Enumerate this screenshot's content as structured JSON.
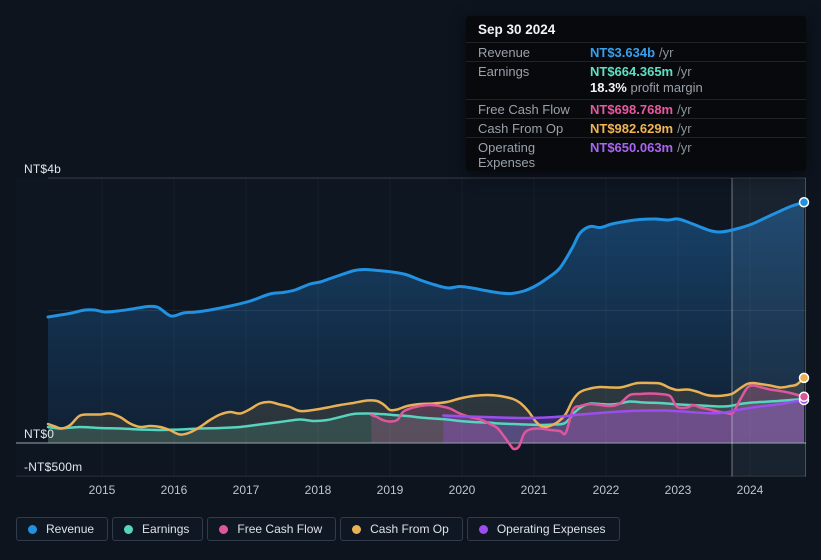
{
  "tooltip": {
    "date": "Sep 30 2024",
    "rows": [
      {
        "label": "Revenue",
        "value": "NT$3.634b",
        "unit": "/yr",
        "color": "#38a0ee"
      },
      {
        "label": "Earnings",
        "value": "NT$664.365m",
        "unit": "/yr",
        "color": "#5fe0c5"
      },
      {
        "label": "Free Cash Flow",
        "value": "NT$698.768m",
        "unit": "/yr",
        "color": "#ea579e"
      },
      {
        "label": "Cash From Op",
        "value": "NT$982.629m",
        "unit": "/yr",
        "color": "#f0b551"
      },
      {
        "label": "Operating Expenses",
        "value": "NT$650.063m",
        "unit": "/yr",
        "color": "#aa65f0"
      }
    ],
    "profit_margin": {
      "value": "18.3%",
      "label": "profit margin"
    }
  },
  "legend": {
    "items": [
      {
        "id": "revenue",
        "label": "Revenue",
        "color": "#2191e2"
      },
      {
        "id": "earnings",
        "label": "Earnings",
        "color": "#56d4be"
      },
      {
        "id": "fcf",
        "label": "Free Cash Flow",
        "color": "#e0569d"
      },
      {
        "id": "cfo",
        "label": "Cash From Op",
        "color": "#e9b156"
      },
      {
        "id": "opex",
        "label": "Operating Expenses",
        "color": "#9b4ded"
      }
    ]
  },
  "chart_data": {
    "type": "line",
    "title": "Earnings and revenue history (TTM, NT$ millions)",
    "xlim": [
      2014.25,
      2024.78
    ],
    "ylim": [
      -500,
      4000
    ],
    "x_ticks": [
      "2015",
      "2016",
      "2017",
      "2018",
      "2019",
      "2020",
      "2021",
      "2022",
      "2023",
      "2024"
    ],
    "y_ticks": [
      {
        "label": "NT$4b",
        "value": 4000
      },
      {
        "label": "NT$0",
        "value": 0
      },
      {
        "label": "-NT$500m",
        "value": -500
      }
    ],
    "y_gridline_values": [
      4000,
      2000,
      0,
      -500
    ],
    "hover_band": [
      2023.75,
      2024.78
    ],
    "line_z_order": [
      "earnings",
      "cfo",
      "fcf",
      "opex",
      "revenue"
    ],
    "dots": [
      {
        "series": "cfo",
        "year": 2024.75,
        "value": 983
      },
      {
        "series": "opex",
        "year": 2024.75,
        "value": 650
      },
      {
        "series": "fcf",
        "year": 2024.75,
        "value": 699
      },
      {
        "series": "revenue",
        "year": 2024.75,
        "value": 3634
      }
    ],
    "series": [
      {
        "id": "revenue",
        "name": "Revenue",
        "color": "#2191e2",
        "fill": "gradient",
        "points": [
          [
            2014.25,
            1902
          ],
          [
            2014.42,
            1932
          ],
          [
            2014.58,
            1962
          ],
          [
            2014.76,
            2008
          ],
          [
            2014.9,
            2008
          ],
          [
            2015.04,
            1977
          ],
          [
            2015.22,
            1992
          ],
          [
            2015.42,
            2023
          ],
          [
            2015.64,
            2060
          ],
          [
            2015.78,
            2045
          ],
          [
            2015.96,
            1917
          ],
          [
            2016.13,
            1962
          ],
          [
            2016.31,
            1977
          ],
          [
            2016.5,
            2008
          ],
          [
            2016.78,
            2068
          ],
          [
            2017.06,
            2143
          ],
          [
            2017.33,
            2249
          ],
          [
            2017.51,
            2272
          ],
          [
            2017.68,
            2309
          ],
          [
            2017.89,
            2400
          ],
          [
            2018.03,
            2430
          ],
          [
            2018.17,
            2483
          ],
          [
            2018.33,
            2543
          ],
          [
            2018.51,
            2604
          ],
          [
            2018.65,
            2619
          ],
          [
            2018.83,
            2604
          ],
          [
            2019.03,
            2581
          ],
          [
            2019.22,
            2543
          ],
          [
            2019.42,
            2460
          ],
          [
            2019.63,
            2385
          ],
          [
            2019.81,
            2340
          ],
          [
            2019.97,
            2362
          ],
          [
            2020.14,
            2340
          ],
          [
            2020.32,
            2302
          ],
          [
            2020.53,
            2264
          ],
          [
            2020.69,
            2257
          ],
          [
            2020.86,
            2294
          ],
          [
            2021.03,
            2377
          ],
          [
            2021.19,
            2491
          ],
          [
            2021.36,
            2642
          ],
          [
            2021.53,
            2944
          ],
          [
            2021.64,
            3170
          ],
          [
            2021.78,
            3268
          ],
          [
            2021.92,
            3253
          ],
          [
            2022.08,
            3306
          ],
          [
            2022.26,
            3343
          ],
          [
            2022.47,
            3374
          ],
          [
            2022.68,
            3381
          ],
          [
            2022.86,
            3366
          ],
          [
            2023.0,
            3381
          ],
          [
            2023.17,
            3321
          ],
          [
            2023.31,
            3260
          ],
          [
            2023.44,
            3208
          ],
          [
            2023.56,
            3185
          ],
          [
            2023.69,
            3200
          ],
          [
            2023.86,
            3245
          ],
          [
            2024.03,
            3306
          ],
          [
            2024.21,
            3396
          ],
          [
            2024.39,
            3487
          ],
          [
            2024.58,
            3577
          ],
          [
            2024.75,
            3634
          ]
        ]
      },
      {
        "id": "earnings",
        "name": "Earnings",
        "color": "#56d4be",
        "fill": "rgba(86,212,190,0.16)",
        "points": [
          [
            2014.25,
            241
          ],
          [
            2014.42,
            219
          ],
          [
            2014.69,
            241
          ],
          [
            2014.97,
            226
          ],
          [
            2015.25,
            219
          ],
          [
            2015.53,
            204
          ],
          [
            2015.81,
            196
          ],
          [
            2016.08,
            204
          ],
          [
            2016.36,
            219
          ],
          [
            2016.64,
            226
          ],
          [
            2016.92,
            241
          ],
          [
            2017.19,
            279
          ],
          [
            2017.47,
            317
          ],
          [
            2017.75,
            355
          ],
          [
            2017.93,
            332
          ],
          [
            2018.13,
            347
          ],
          [
            2018.31,
            392
          ],
          [
            2018.49,
            438
          ],
          [
            2018.68,
            445
          ],
          [
            2018.86,
            438
          ],
          [
            2019.04,
            423
          ],
          [
            2019.24,
            408
          ],
          [
            2019.42,
            385
          ],
          [
            2019.6,
            370
          ],
          [
            2019.79,
            355
          ],
          [
            2019.97,
            332
          ],
          [
            2020.15,
            317
          ],
          [
            2020.35,
            309
          ],
          [
            2020.53,
            294
          ],
          [
            2020.71,
            287
          ],
          [
            2020.9,
            279
          ],
          [
            2021.08,
            272
          ],
          [
            2021.26,
            279
          ],
          [
            2021.43,
            302
          ],
          [
            2021.57,
            468
          ],
          [
            2021.68,
            558
          ],
          [
            2021.78,
            596
          ],
          [
            2021.92,
            589
          ],
          [
            2022.06,
            581
          ],
          [
            2022.19,
            596
          ],
          [
            2022.33,
            626
          ],
          [
            2022.54,
            611
          ],
          [
            2022.75,
            604
          ],
          [
            2022.96,
            586
          ],
          [
            2023.17,
            574
          ],
          [
            2023.38,
            562
          ],
          [
            2023.58,
            551
          ],
          [
            2023.72,
            558
          ],
          [
            2023.86,
            589
          ],
          [
            2024.03,
            611
          ],
          [
            2024.21,
            622
          ],
          [
            2024.39,
            634
          ],
          [
            2024.56,
            649
          ],
          [
            2024.75,
            664
          ]
        ]
      },
      {
        "id": "cfo",
        "name": "Cash From Op",
        "color": "#e9b156",
        "fill": "rgba(233,177,86,0.13)",
        "points": [
          [
            2014.25,
            287
          ],
          [
            2014.35,
            249
          ],
          [
            2014.44,
            219
          ],
          [
            2014.56,
            272
          ],
          [
            2014.69,
            412
          ],
          [
            2014.83,
            430
          ],
          [
            2014.97,
            430
          ],
          [
            2015.11,
            445
          ],
          [
            2015.25,
            392
          ],
          [
            2015.39,
            294
          ],
          [
            2015.53,
            241
          ],
          [
            2015.67,
            257
          ],
          [
            2015.81,
            241
          ],
          [
            2015.94,
            196
          ],
          [
            2016.08,
            128
          ],
          [
            2016.22,
            158
          ],
          [
            2016.36,
            241
          ],
          [
            2016.5,
            347
          ],
          [
            2016.64,
            430
          ],
          [
            2016.78,
            468
          ],
          [
            2016.92,
            445
          ],
          [
            2017.06,
            513
          ],
          [
            2017.19,
            596
          ],
          [
            2017.33,
            619
          ],
          [
            2017.47,
            581
          ],
          [
            2017.61,
            543
          ],
          [
            2017.75,
            483
          ],
          [
            2017.93,
            498
          ],
          [
            2018.13,
            536
          ],
          [
            2018.31,
            574
          ],
          [
            2018.49,
            604
          ],
          [
            2018.68,
            641
          ],
          [
            2018.82,
            634
          ],
          [
            2018.92,
            574
          ],
          [
            2019.0,
            498
          ],
          [
            2019.1,
            506
          ],
          [
            2019.24,
            558
          ],
          [
            2019.42,
            589
          ],
          [
            2019.6,
            596
          ],
          [
            2019.79,
            619
          ],
          [
            2019.97,
            672
          ],
          [
            2020.15,
            709
          ],
          [
            2020.35,
            724
          ],
          [
            2020.53,
            709
          ],
          [
            2020.71,
            664
          ],
          [
            2020.81,
            604
          ],
          [
            2020.92,
            483
          ],
          [
            2021.03,
            317
          ],
          [
            2021.13,
            241
          ],
          [
            2021.22,
            257
          ],
          [
            2021.33,
            317
          ],
          [
            2021.44,
            438
          ],
          [
            2021.54,
            649
          ],
          [
            2021.64,
            770
          ],
          [
            2021.78,
            823
          ],
          [
            2021.92,
            845
          ],
          [
            2022.06,
            838
          ],
          [
            2022.19,
            838
          ],
          [
            2022.31,
            868
          ],
          [
            2022.44,
            906
          ],
          [
            2022.61,
            906
          ],
          [
            2022.75,
            898
          ],
          [
            2022.89,
            830
          ],
          [
            2022.99,
            800
          ],
          [
            2023.13,
            808
          ],
          [
            2023.26,
            777
          ],
          [
            2023.4,
            724
          ],
          [
            2023.54,
            709
          ],
          [
            2023.68,
            724
          ],
          [
            2023.76,
            747
          ],
          [
            2023.86,
            823
          ],
          [
            2023.96,
            891
          ],
          [
            2024.04,
            906
          ],
          [
            2024.14,
            891
          ],
          [
            2024.28,
            868
          ],
          [
            2024.42,
            838
          ],
          [
            2024.56,
            860
          ],
          [
            2024.65,
            883
          ],
          [
            2024.75,
            983
          ]
        ]
      },
      {
        "id": "fcf",
        "name": "Free Cash Flow",
        "color": "#e0569d",
        "fill": "rgba(224,86,157,0.22)",
        "points": [
          [
            2018.74,
            423
          ],
          [
            2018.82,
            392
          ],
          [
            2018.9,
            347
          ],
          [
            2019.0,
            325
          ],
          [
            2019.1,
            347
          ],
          [
            2019.18,
            468
          ],
          [
            2019.28,
            521
          ],
          [
            2019.42,
            558
          ],
          [
            2019.56,
            574
          ],
          [
            2019.69,
            558
          ],
          [
            2019.83,
            521
          ],
          [
            2019.97,
            445
          ],
          [
            2020.11,
            392
          ],
          [
            2020.25,
            355
          ],
          [
            2020.39,
            287
          ],
          [
            2020.49,
            226
          ],
          [
            2020.58,
            106
          ],
          [
            2020.67,
            -30
          ],
          [
            2020.72,
            -90
          ],
          [
            2020.79,
            -53
          ],
          [
            2020.86,
            136
          ],
          [
            2020.94,
            204
          ],
          [
            2021.08,
            219
          ],
          [
            2021.22,
            196
          ],
          [
            2021.36,
            181
          ],
          [
            2021.44,
            151
          ],
          [
            2021.54,
            500
          ],
          [
            2021.64,
            558
          ],
          [
            2021.78,
            589
          ],
          [
            2021.92,
            574
          ],
          [
            2022.06,
            558
          ],
          [
            2022.19,
            596
          ],
          [
            2022.33,
            724
          ],
          [
            2022.47,
            740
          ],
          [
            2022.61,
            747
          ],
          [
            2022.75,
            740
          ],
          [
            2022.89,
            709
          ],
          [
            2022.99,
            543
          ],
          [
            2023.13,
            536
          ],
          [
            2023.21,
            574
          ],
          [
            2023.31,
            536
          ],
          [
            2023.44,
            506
          ],
          [
            2023.58,
            468
          ],
          [
            2023.68,
            453
          ],
          [
            2023.76,
            453
          ],
          [
            2023.86,
            649
          ],
          [
            2023.96,
            830
          ],
          [
            2024.04,
            868
          ],
          [
            2024.14,
            845
          ],
          [
            2024.28,
            808
          ],
          [
            2024.42,
            785
          ],
          [
            2024.56,
            755
          ],
          [
            2024.75,
            699
          ]
        ]
      },
      {
        "id": "opex",
        "name": "Operating Expenses",
        "color": "#9b4ded",
        "fill": "rgba(155,77,237,0.30)",
        "points": [
          [
            2019.74,
            415
          ],
          [
            2020.11,
            400
          ],
          [
            2020.53,
            385
          ],
          [
            2020.94,
            377
          ],
          [
            2021.29,
            392
          ],
          [
            2021.64,
            430
          ],
          [
            2021.99,
            460
          ],
          [
            2022.33,
            483
          ],
          [
            2022.68,
            491
          ],
          [
            2022.89,
            487
          ],
          [
            2023.17,
            468
          ],
          [
            2023.44,
            449
          ],
          [
            2023.65,
            460
          ],
          [
            2023.86,
            506
          ],
          [
            2024.14,
            551
          ],
          [
            2024.42,
            589
          ],
          [
            2024.75,
            650
          ]
        ]
      }
    ]
  }
}
